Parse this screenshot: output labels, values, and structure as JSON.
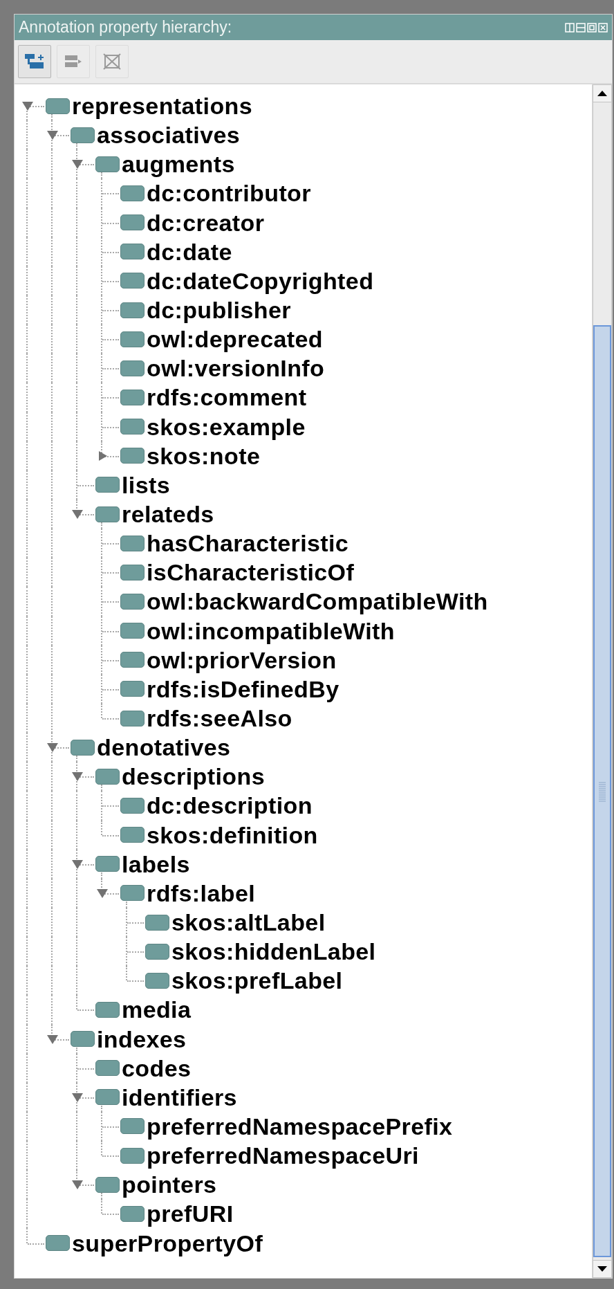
{
  "panel": {
    "title": "Annotation property hierarchy:"
  },
  "toolbar": [
    {
      "kind": "add",
      "disabled": false
    },
    {
      "kind": "move",
      "disabled": true
    },
    {
      "kind": "delete",
      "disabled": true
    }
  ],
  "tree": [
    {
      "label": "representations",
      "expanded": true,
      "children": [
        {
          "label": "associatives",
          "expanded": true,
          "children": [
            {
              "label": "augments",
              "expanded": true,
              "children": [
                {
                  "label": "dc:contributor"
                },
                {
                  "label": "dc:creator"
                },
                {
                  "label": "dc:date"
                },
                {
                  "label": "dc:dateCopyrighted"
                },
                {
                  "label": "dc:publisher"
                },
                {
                  "label": "owl:deprecated"
                },
                {
                  "label": "owl:versionInfo"
                },
                {
                  "label": "rdfs:comment"
                },
                {
                  "label": "skos:example"
                },
                {
                  "label": "skos:note",
                  "expanded": false
                }
              ]
            },
            {
              "label": "lists"
            },
            {
              "label": "relateds",
              "expanded": true,
              "children": [
                {
                  "label": "hasCharacteristic"
                },
                {
                  "label": "isCharacteristicOf"
                },
                {
                  "label": "owl:backwardCompatibleWith"
                },
                {
                  "label": "owl:incompatibleWith"
                },
                {
                  "label": "owl:priorVersion"
                },
                {
                  "label": "rdfs:isDefinedBy"
                },
                {
                  "label": "rdfs:seeAlso"
                }
              ]
            }
          ]
        },
        {
          "label": "denotatives",
          "expanded": true,
          "children": [
            {
              "label": "descriptions",
              "expanded": true,
              "children": [
                {
                  "label": "dc:description"
                },
                {
                  "label": "skos:definition"
                }
              ]
            },
            {
              "label": "labels",
              "expanded": true,
              "children": [
                {
                  "label": "rdfs:label",
                  "expanded": true,
                  "children": [
                    {
                      "label": "skos:altLabel"
                    },
                    {
                      "label": "skos:hiddenLabel"
                    },
                    {
                      "label": "skos:prefLabel"
                    }
                  ]
                }
              ]
            },
            {
              "label": "media"
            }
          ]
        },
        {
          "label": "indexes",
          "expanded": true,
          "children": [
            {
              "label": "codes"
            },
            {
              "label": "identifiers",
              "expanded": true,
              "children": [
                {
                  "label": "preferredNamespacePrefix"
                },
                {
                  "label": "preferredNamespaceUri"
                }
              ]
            },
            {
              "label": "pointers",
              "expanded": true,
              "children": [
                {
                  "label": "prefURI"
                }
              ]
            }
          ]
        }
      ]
    },
    {
      "label": "superPropertyOf"
    }
  ]
}
